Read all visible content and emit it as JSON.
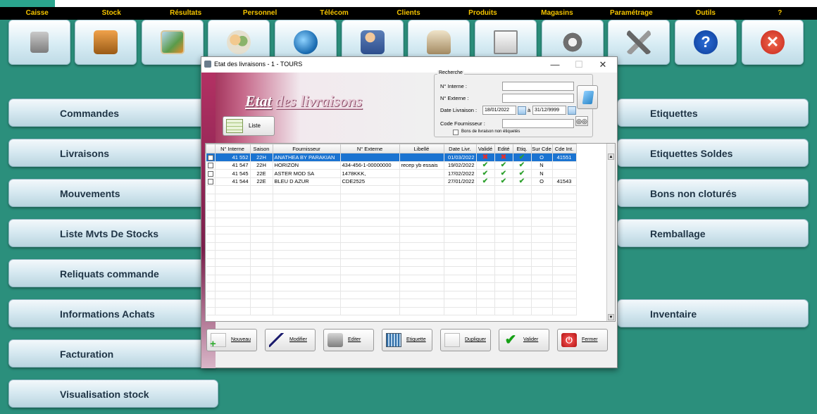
{
  "menu": [
    "Caisse",
    "Stock",
    "Résultats",
    "Personnel",
    "Télécom",
    "Clients",
    "Produits",
    "Magasins",
    "Paramétrage",
    "Outils",
    "?"
  ],
  "toolbar_icons": [
    "cash-register-icon",
    "stock-boxes-icon",
    "results-chart-icon",
    "staff-icon",
    "telecom-globe-icon",
    "clients-icon",
    "products-icon",
    "stores-icon",
    "settings-gears-icon",
    "tools-icon",
    "help-icon",
    "close-app-icon"
  ],
  "nav_left": [
    "Commandes",
    "Livraisons",
    "Mouvements",
    "Liste Mvts De Stocks",
    "Reliquats commande",
    "Informations Achats",
    "Facturation",
    "Visualisation stock"
  ],
  "nav_right": [
    "Etiquettes",
    "Etiquettes Soldes",
    "Bons non cloturés",
    "Remballage",
    "Inventaire"
  ],
  "window": {
    "title": "Etat des livraisons - 1 - TOURS",
    "minimize": "—",
    "maximize": "☐",
    "close": "✕",
    "heading_word1": "Etat",
    "heading_word2": "des livraisons",
    "liste_button": "Liste"
  },
  "search": {
    "legend": "Recherche",
    "num_interne_label": "N° Interne :",
    "num_interne_value": "",
    "num_externe_label": "N° Externe :",
    "num_externe_value": "",
    "date_label": "Date Livraison :",
    "date_from": "18/01/2022",
    "date_sep": "à",
    "date_to": "31/12/9999",
    "fournisseur_label": "Code Fournisseur :",
    "fournisseur_value": "",
    "checkbox_label": "Bons de livraison non étiquetés"
  },
  "table": {
    "columns": [
      "N° Interne",
      "Saison",
      "Fournisseur",
      "N° Externe",
      "Libellé",
      "Date Livr.",
      "Validé",
      "Edité",
      "Etiq.",
      "Sur Cde",
      "Cde Int."
    ],
    "rows": [
      {
        "interne": "41 552",
        "saison": "22H",
        "fournisseur": "ANATHEA BY PARAKIAN",
        "externe": "",
        "libelle": "",
        "date": "01/03/2022",
        "valide": "ko",
        "edite": "ko",
        "etiq": "ok",
        "surcde": "O",
        "cdeint": "41551",
        "selected": true
      },
      {
        "interne": "41 547",
        "saison": "22H",
        "fournisseur": "HORIZON",
        "externe": "434-456-1-00000000",
        "libelle": "recep yb essais",
        "date": "19/02/2022",
        "valide": "ok",
        "edite": "ok",
        "etiq": "ok",
        "surcde": "N",
        "cdeint": "",
        "selected": false
      },
      {
        "interne": "41 545",
        "saison": "22E",
        "fournisseur": "ASTER MOD SA",
        "externe": "1478KKK,",
        "libelle": "",
        "date": "17/02/2022",
        "valide": "ok",
        "edite": "ok",
        "etiq": "ok",
        "surcde": "N",
        "cdeint": "",
        "selected": false
      },
      {
        "interne": "41 544",
        "saison": "22E",
        "fournisseur": "BLEU D AZUR",
        "externe": "CDE2525",
        "libelle": "",
        "date": "27/01/2022",
        "valide": "ok",
        "edite": "ok",
        "etiq": "ok",
        "surcde": "O",
        "cdeint": "41543",
        "selected": false
      }
    ],
    "empty_rows": 16
  },
  "actions": [
    "Nouveau",
    "Modifier",
    "Editer",
    "Etiquette",
    "Dupliquer",
    "Valider",
    "Fermer"
  ],
  "colors": {
    "background": "#2b8f7c",
    "menu_text": "#f5c400",
    "selection": "#1a73d1",
    "accent": "#a5375f"
  }
}
